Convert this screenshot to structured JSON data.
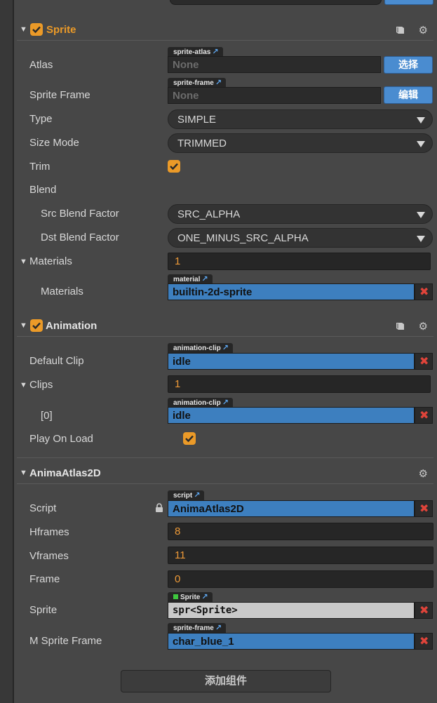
{
  "sprite": {
    "title": "Sprite",
    "atlas": {
      "label": "Atlas",
      "tag": "sprite-atlas",
      "value": "None",
      "button": "选择"
    },
    "sprite_frame": {
      "label": "Sprite Frame",
      "tag": "sprite-frame",
      "value": "None",
      "button": "编辑"
    },
    "type": {
      "label": "Type",
      "value": "SIMPLE"
    },
    "size_mode": {
      "label": "Size Mode",
      "value": "TRIMMED"
    },
    "trim": {
      "label": "Trim",
      "checked": true
    },
    "blend": {
      "label": "Blend"
    },
    "src_blend": {
      "label": "Src Blend Factor",
      "value": "SRC_ALPHA"
    },
    "dst_blend": {
      "label": "Dst Blend Factor",
      "value": "ONE_MINUS_SRC_ALPHA"
    },
    "materials_count": {
      "label": "Materials",
      "value": "1"
    },
    "materials_item": {
      "label": "Materials",
      "tag": "material",
      "value": "builtin-2d-sprite"
    }
  },
  "animation": {
    "title": "Animation",
    "default_clip": {
      "label": "Default Clip",
      "tag": "animation-clip",
      "value": "idle"
    },
    "clips": {
      "label": "Clips",
      "value": "1"
    },
    "clip0": {
      "label": "[0]",
      "tag": "animation-clip",
      "value": "idle"
    },
    "play_on_load": {
      "label": "Play On Load",
      "checked": true
    }
  },
  "anima": {
    "title": "AnimaAtlas2D",
    "script": {
      "label": "Script",
      "tag": "script",
      "value": "AnimaAtlas2D"
    },
    "hframes": {
      "label": "Hframes",
      "value": "8"
    },
    "vframes": {
      "label": "Vframes",
      "value": "11"
    },
    "frame": {
      "label": "Frame",
      "value": "0"
    },
    "sprite": {
      "label": "Sprite",
      "tag": "Sprite",
      "value": "spr<Sprite>"
    },
    "m_sprite_frame": {
      "label": "M Sprite Frame",
      "tag": "sprite-frame",
      "value": "char_blue_1"
    }
  },
  "add_component": "添加组件",
  "colors": {
    "accent": "#eb9a28",
    "asset_blue": "#3d7fbf",
    "button_blue": "#4a8cd0",
    "remove_red": "#e0443a"
  }
}
